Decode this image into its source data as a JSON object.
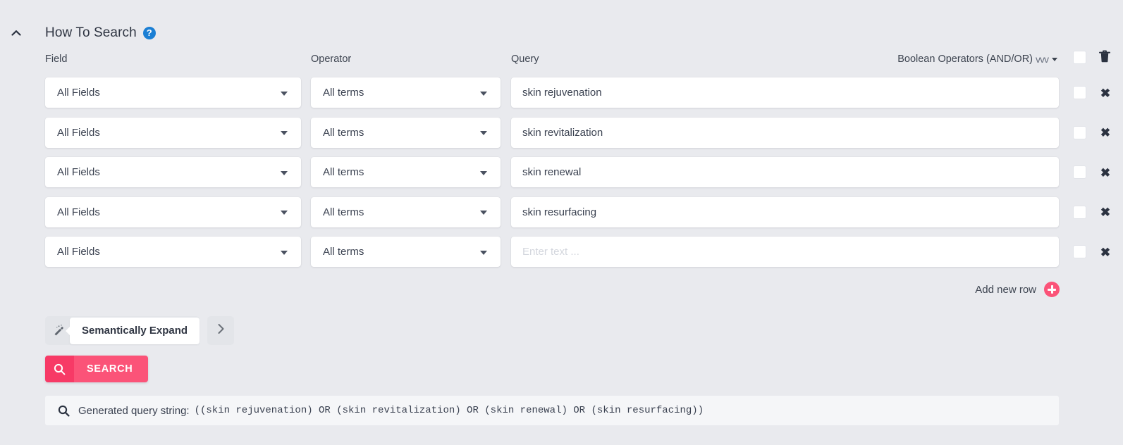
{
  "panel": {
    "title": "How To Search",
    "help_icon_label": "?",
    "collapse_icon": "chevron-up-icon"
  },
  "columns": {
    "field": "Field",
    "operator": "Operator",
    "query": "Query",
    "boolean_operators": "Boolean Operators (AND/OR)",
    "boolean_operators_suffix": "vvv"
  },
  "rows": [
    {
      "field": "All Fields",
      "operator": "All terms",
      "query": "skin rejuvenation",
      "query_placeholder": "Enter text ...",
      "checked": false,
      "remove_label": "✖"
    },
    {
      "field": "All Fields",
      "operator": "All terms",
      "query": "skin revitalization",
      "query_placeholder": "Enter text ...",
      "checked": false,
      "remove_label": "✖"
    },
    {
      "field": "All Fields",
      "operator": "All terms",
      "query": "skin renewal",
      "query_placeholder": "Enter text ...",
      "checked": false,
      "remove_label": "✖"
    },
    {
      "field": "All Fields",
      "operator": "All terms",
      "query": "skin resurfacing",
      "query_placeholder": "Enter text ...",
      "checked": false,
      "remove_label": "✖"
    },
    {
      "field": "All Fields",
      "operator": "All terms",
      "query": "",
      "query_placeholder": "Enter text ...",
      "checked": false,
      "remove_label": "✖"
    }
  ],
  "add_row": {
    "label": "Add new row"
  },
  "semantic_expand": {
    "label": "Semantically Expand"
  },
  "search": {
    "label": "SEARCH"
  },
  "generated": {
    "label": "Generated query string:",
    "query": "((skin rejuvenation) OR (skin revitalization) OR (skin renewal) OR (skin resurfacing))"
  },
  "colors": {
    "background": "#e9eaee",
    "accent_pink": "#fb5378",
    "accent_pink_dark": "#f73a66",
    "help_blue": "#1b7fd4",
    "text": "#2f3542",
    "bar_background": "#f5f6f8"
  }
}
